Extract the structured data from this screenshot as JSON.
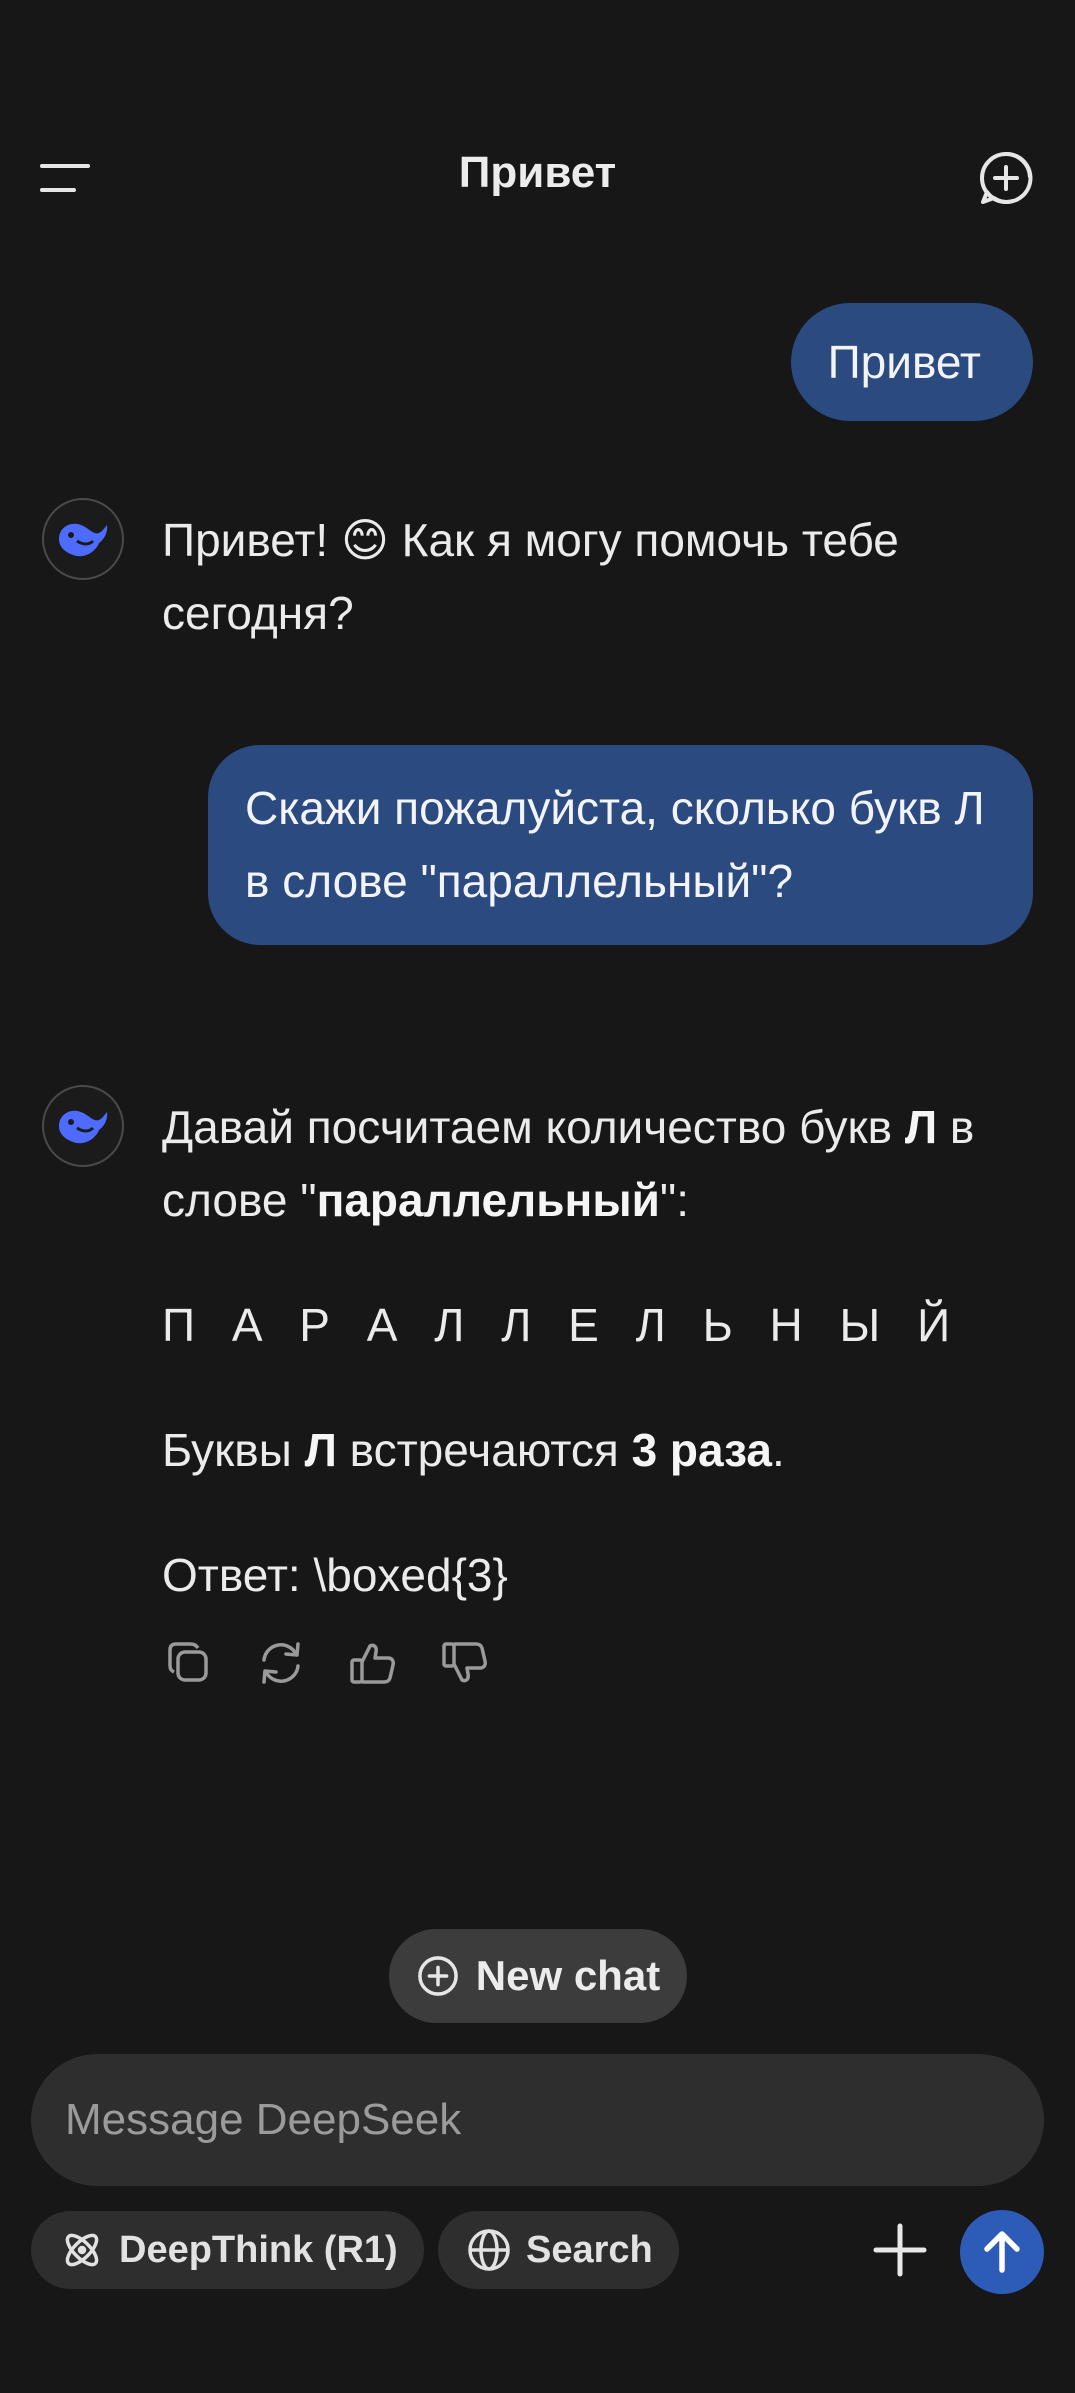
{
  "header": {
    "title": "Привет"
  },
  "messages": {
    "user1": "Привет",
    "ai1": "Привет! 😊 Как я могу помочь тебе сегодня?",
    "user2": "Скажи пожалуйста, сколько букв Л в слове \"параллельный\"?",
    "ai2": {
      "line1_a": "Давай посчитаем количество букв ",
      "line1_b": "Л",
      "line1_c": " в слове \"",
      "line1_d": "параллельный",
      "line1_e": "\":",
      "spelled": "П А Р А Л Л Е Л Ь Н Ы Й",
      "line3_a": "Буквы ",
      "line3_b": "Л",
      "line3_c": " встречаются ",
      "line3_d": "3 раза",
      "line3_e": ".",
      "answer": "Ответ: \\boxed{3}"
    }
  },
  "new_chat_label": "New chat",
  "input": {
    "placeholder": "Message DeepSeek"
  },
  "toolbar": {
    "deepthink_label": "DeepThink (R1)",
    "search_label": "Search"
  },
  "colors": {
    "background": "#171717",
    "user_bubble": "#2b4a7f",
    "accent": "#2d5cb8",
    "logo": "#4d6bfe"
  }
}
